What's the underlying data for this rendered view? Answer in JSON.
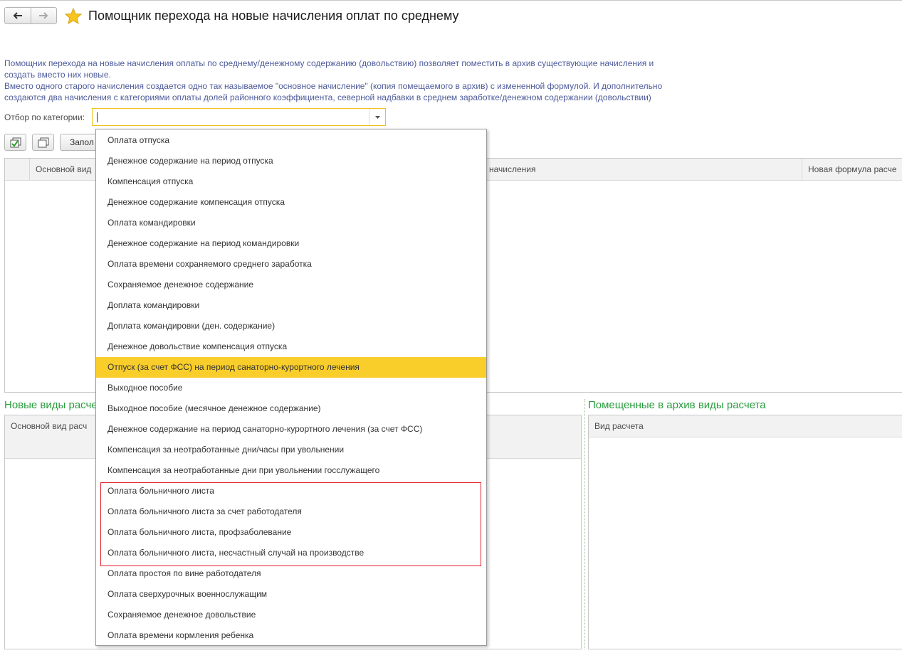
{
  "window": {
    "title": "Помощник перехода на новые начисления оплат по среднему"
  },
  "description": {
    "lines": [
      "Помощник перехода на новые начисления оплаты по среднему/денежному содержанию (довольствию) позволяет поместить в архив существующие начисления и",
      "создать вместо них новые.",
      "Вместо одного старого начисления создается одно так называемое \"основное начисление\" (копия помещаемого в архив) с измененной формулой. И дополнительно",
      "создаются два начисления с категориями оплаты долей районного коэффициента, северной надбавки в среднем заработке/денежном содержании (довольствии)"
    ]
  },
  "filter": {
    "label": "Отбор по категории:",
    "value": ""
  },
  "toolbar": {
    "fill_label": "Запол"
  },
  "main_table": {
    "columns": [
      "Основной вид",
      "начисления",
      "Новая формула расче"
    ]
  },
  "new_section": {
    "title": "Новые виды расче",
    "column": "Основной вид расч"
  },
  "archive_section": {
    "title": "Помещенные в архив виды расчета",
    "column": "Вид расчета"
  },
  "dropdown": {
    "selected_index": 11,
    "items": [
      "Оплата отпуска",
      "Денежное содержание на период отпуска",
      "Компенсация отпуска",
      "Денежное содержание компенсация отпуска",
      "Оплата командировки",
      "Денежное содержание на период командировки",
      "Оплата времени сохраняемого среднего заработка",
      "Сохраняемое денежное содержание",
      "Доплата командировки",
      "Доплата командировки (ден. содержание)",
      "Денежное довольствие компенсация отпуска",
      "Отпуск (за счет ФСС) на период санаторно-курортного лечения",
      "Выходное пособие",
      "Выходное пособие (месячное денежное содержание)",
      "Денежное содержание на период санаторно-курортного лечения (за счет ФСС)",
      "Компенсация за неотработанные дни/часы при увольнении",
      "Компенсация за неотработанные дни при увольнении госслужащего",
      "Оплата больничного листа",
      "Оплата больничного листа за счет работодателя",
      "Оплата больничного листа, профзаболевание",
      "Оплата больничного листа, несчастный случай на производстве",
      "Оплата простоя по вине работодателя",
      "Оплата сверхурочных военнослужащим",
      "Сохраняемое денежное довольствие",
      "Оплата времени кормления ребенка"
    ]
  },
  "colors": {
    "accent": "#f9cd2a",
    "section_title": "#2a9d3e",
    "description_text": "#4d5b9a",
    "annotation_red": "#e0222a"
  }
}
